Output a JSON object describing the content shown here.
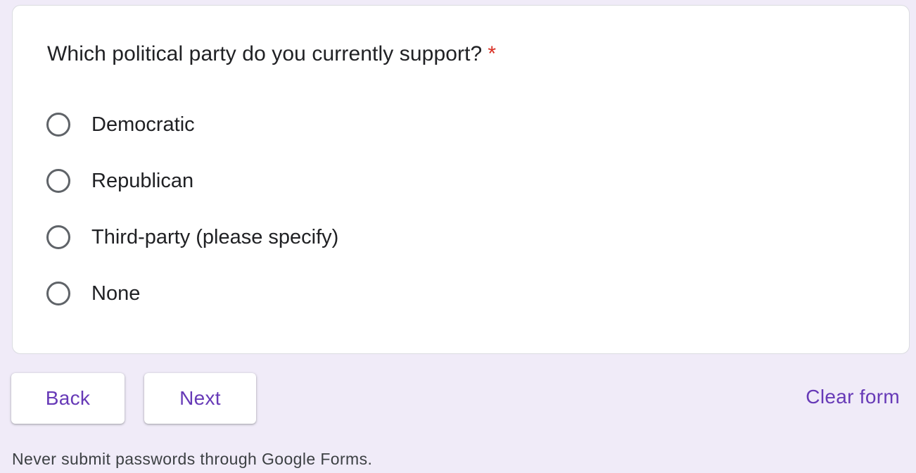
{
  "question": {
    "title": "Which political party do you currently support?",
    "required_marker": "*",
    "options": [
      {
        "label": "Democratic",
        "selected": false
      },
      {
        "label": "Republican",
        "selected": false
      },
      {
        "label": "Third-party (please specify)",
        "selected": false
      },
      {
        "label": "None",
        "selected": false
      }
    ]
  },
  "navigation": {
    "back_label": "Back",
    "next_label": "Next",
    "clear_label": "Clear form"
  },
  "footer": {
    "note": "Never submit passwords through Google Forms."
  },
  "colors": {
    "background": "#f0ebf8",
    "accent": "#673ab7",
    "required": "#d93025",
    "radio_border": "#5f6368"
  }
}
